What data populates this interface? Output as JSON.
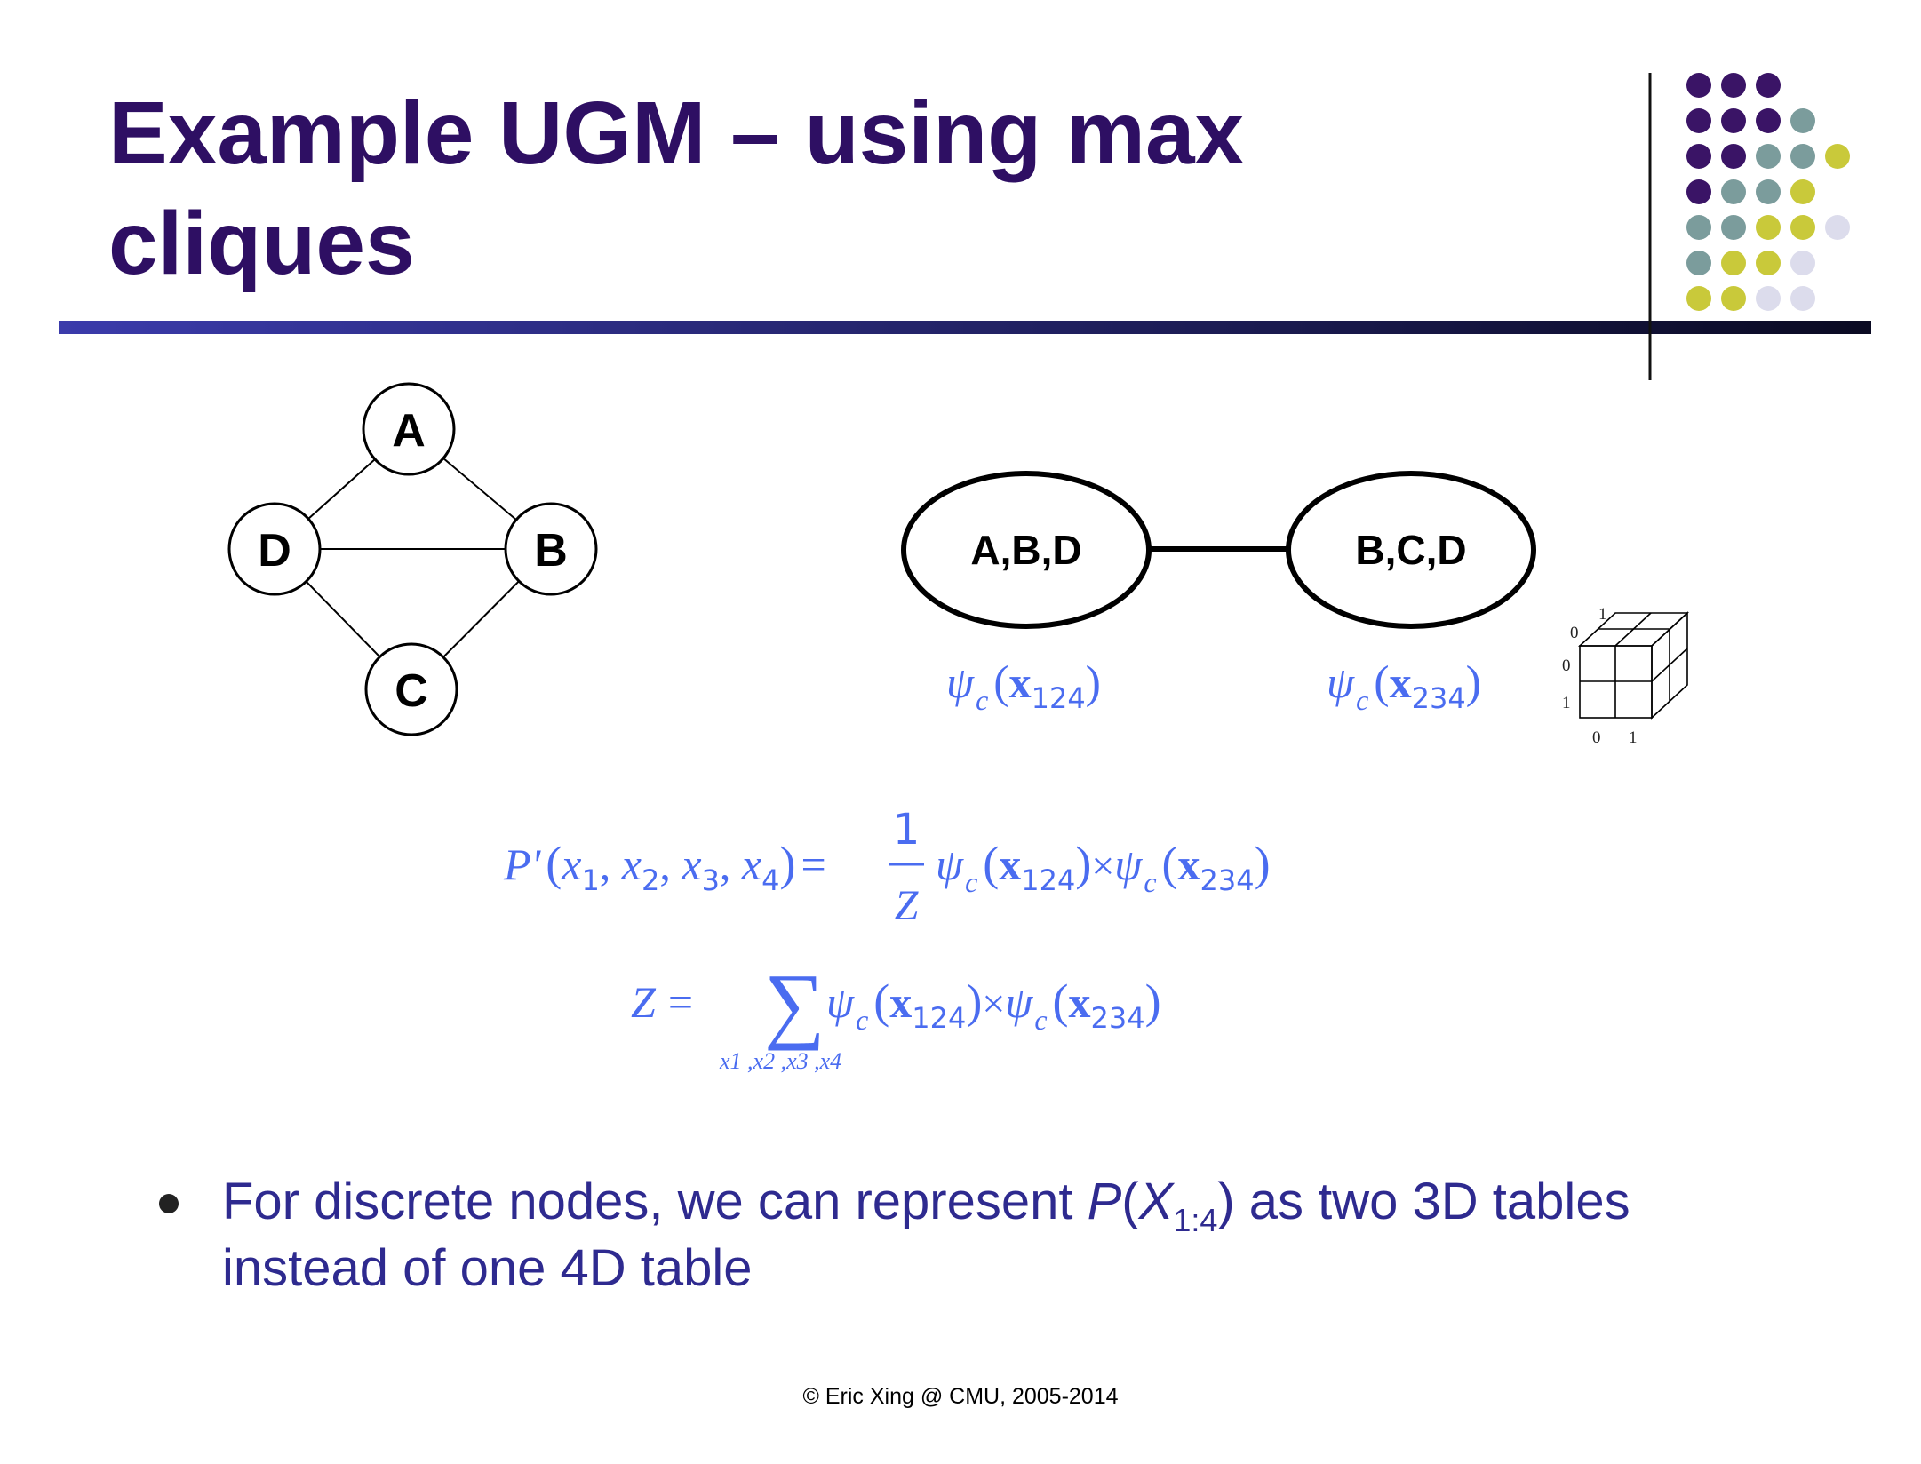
{
  "slide": {
    "title_line1": "Example UGM – using max",
    "title_line2": "cliques",
    "footer": "© Eric Xing @ CMU, 2005-2014"
  },
  "graph": {
    "nodes": [
      "A",
      "B",
      "C",
      "D"
    ]
  },
  "clique_tree": {
    "clique1": "A,B,D",
    "clique2": "B,C,D",
    "potential_symbol": "ψ",
    "potential_sub": "c",
    "potential1_index": "124",
    "potential2_index": "234"
  },
  "table_ticks": {
    "zero": "0",
    "one": "1"
  },
  "equations": {
    "p_lhs": "P'",
    "vars": [
      "x",
      "x",
      "x",
      "x"
    ],
    "var_subs": [
      "1",
      "2",
      "3",
      "4"
    ],
    "frac_num": "1",
    "frac_den": "Z",
    "z": "Z",
    "sum_sub": "x1 ,x2 ,x3 ,x4"
  },
  "bullet": {
    "text_a": "For discrete nodes, we can represent ",
    "p": "P",
    "x": "X",
    "sub": "1:4",
    "text_b": " as two 3D tables",
    "line2": "instead of one 4D table"
  },
  "colors": {
    "title": "#2e0f63",
    "math": "#4a6cf0",
    "bullet_text": "#2e2a8f",
    "dot_purple": "#3a1466",
    "dot_teal": "#7b9c9c",
    "dot_olive": "#c9c93a",
    "dot_lavender": "#dcdcec"
  }
}
